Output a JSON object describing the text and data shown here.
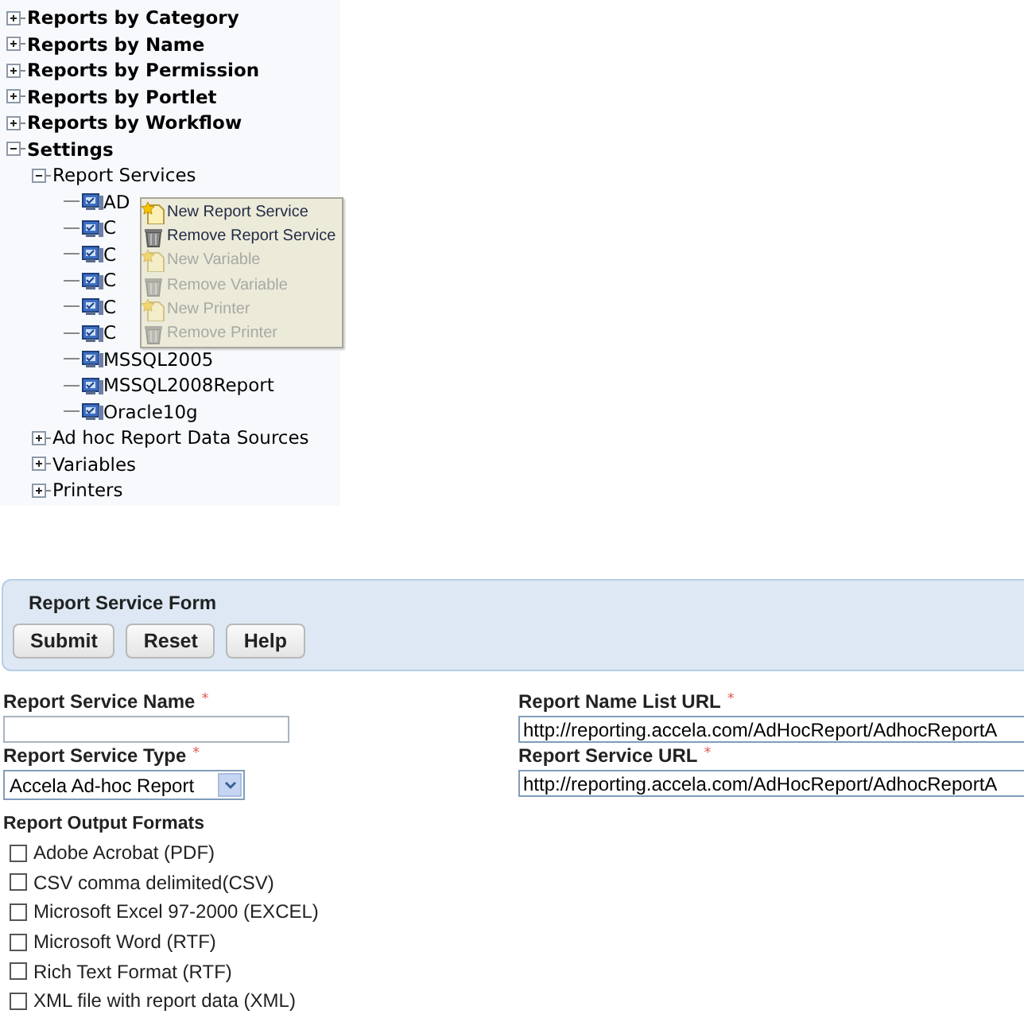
{
  "tree": [
    {
      "label": "Reports by Category",
      "expanded": false
    },
    {
      "label": "Reports by Name",
      "expanded": false
    },
    {
      "label": "Reports by Permission",
      "expanded": false
    },
    {
      "label": "Reports by Portlet",
      "expanded": false
    },
    {
      "label": "Reports by Workflow",
      "expanded": false
    },
    {
      "label": "Settings",
      "expanded": true,
      "children": [
        {
          "label": "Report Services",
          "expanded": true,
          "children": [
            {
              "label": "AD",
              "kind": "service"
            },
            {
              "label": "C",
              "kind": "service"
            },
            {
              "label": "C",
              "kind": "service"
            },
            {
              "label": "C",
              "kind": "service"
            },
            {
              "label": "C",
              "kind": "service"
            },
            {
              "label": "C",
              "kind": "service"
            },
            {
              "label": "MSSQL2005",
              "kind": "service"
            },
            {
              "label": "MSSQL2008Report",
              "kind": "service"
            },
            {
              "label": "Oracle10g",
              "kind": "service"
            }
          ]
        },
        {
          "label": "Ad hoc Report Data Sources",
          "expanded": false
        },
        {
          "label": "Variables",
          "expanded": false
        },
        {
          "label": "Printers",
          "expanded": false
        }
      ]
    }
  ],
  "context_menu": [
    {
      "label": "New Report Service",
      "kind": "new",
      "disabled": false
    },
    {
      "label": "Remove Report Service",
      "kind": "remove",
      "disabled": false
    },
    {
      "label": "New Variable",
      "kind": "new",
      "disabled": true
    },
    {
      "label": "Remove Variable",
      "kind": "remove",
      "disabled": true
    },
    {
      "label": "New Printer",
      "kind": "new",
      "disabled": true
    },
    {
      "label": "Remove Printer",
      "kind": "remove",
      "disabled": true
    }
  ],
  "form": {
    "title": "Report Service Form",
    "buttons": [
      "Submit",
      "Reset",
      "Help"
    ],
    "fields": [
      {
        "label": "Report Service Name",
        "required": "*",
        "kind": "text"
      },
      {
        "label": "Report Name List URL",
        "required": "*",
        "kind": "text",
        "value": "http://reporting.accela.com/AdHocReport/AdhocReportA"
      },
      {
        "label": "Report Service Type",
        "required": "*",
        "kind": "select",
        "value": "Accela Ad-hoc Report"
      },
      {
        "label": "Report Service URL",
        "required": "*",
        "kind": "text",
        "value": "http://reporting.accela.com/AdHocReport/AdhocReportA"
      }
    ],
    "output_formats": {
      "label": "Report Output Formats",
      "options": [
        {
          "label": "Adobe Acrobat (PDF)",
          "checked": false
        },
        {
          "label": "CSV comma delimited(CSV)",
          "checked": false
        },
        {
          "label": "Microsoft Excel 97-2000 (EXCEL)",
          "checked": false
        },
        {
          "label": "Microsoft Word (RTF)",
          "checked": false
        },
        {
          "label": "Rich Text Format (RTF)",
          "checked": false
        },
        {
          "label": "XML file with report data (XML)",
          "checked": false
        }
      ]
    }
  }
}
